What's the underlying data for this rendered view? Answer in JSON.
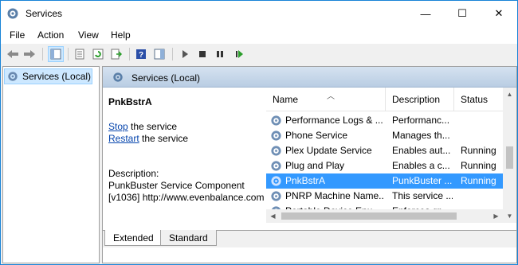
{
  "window": {
    "title": "Services",
    "minimize": "—",
    "maximize": "☐",
    "close": "✕"
  },
  "menu": [
    "File",
    "Action",
    "View",
    "Help"
  ],
  "toolbar": {
    "icons": [
      "back-arrow-icon",
      "forward-arrow-icon",
      "console-tree-icon",
      "properties-icon",
      "refresh-icon",
      "export-icon",
      "help-icon",
      "show-hide-icon",
      "start-service-icon",
      "stop-service-icon",
      "pause-service-icon",
      "restart-service-icon"
    ]
  },
  "tree": {
    "item_label": "Services (Local)"
  },
  "main": {
    "header_title": "Services (Local)",
    "service_name": "PnkBstrA",
    "stop_link": "Stop",
    "stop_suffix": " the service",
    "restart_link": "Restart",
    "restart_suffix": " the service",
    "description_label": "Description:",
    "description_line1": "PunkBuster Service Component",
    "description_line2": "[v1036] http://www.evenbalance.com"
  },
  "list": {
    "columns": [
      "Name",
      "Description",
      "Status"
    ],
    "rows": [
      {
        "name": "Performance Logs & ...",
        "description": "Performanc...",
        "status": ""
      },
      {
        "name": "Phone Service",
        "description": "Manages th...",
        "status": ""
      },
      {
        "name": "Plex Update Service",
        "description": "Enables aut...",
        "status": "Running"
      },
      {
        "name": "Plug and Play",
        "description": "Enables a c...",
        "status": "Running"
      },
      {
        "name": "PnkBstrA",
        "description": "PunkBuster ...",
        "status": "Running",
        "selected": true
      },
      {
        "name": "PNRP Machine Name...",
        "description": "This service ...",
        "status": ""
      },
      {
        "name": "Portable Device Enu...",
        "description": "Enforces gr...",
        "status": ""
      }
    ]
  },
  "tabs": [
    "Extended",
    "Standard"
  ],
  "colors": {
    "selection": "#3399ff",
    "header_gradient_top": "#d5e2f0",
    "link": "#0645ad",
    "window_border": "#1883d7"
  }
}
